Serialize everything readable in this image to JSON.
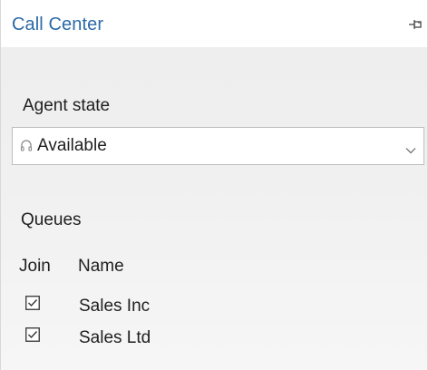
{
  "panel": {
    "title": "Call Center",
    "pin_icon": "pin-icon"
  },
  "agent_state": {
    "label": "Agent state",
    "selected_value": "Available",
    "status_icon": "headset-icon",
    "chevron_icon": "chevron-down-icon"
  },
  "queues": {
    "label": "Queues",
    "columns": {
      "join": "Join",
      "name": "Name"
    },
    "rows": [
      {
        "joined": true,
        "name": "Sales Inc"
      },
      {
        "joined": true,
        "name": "Sales Ltd"
      }
    ]
  },
  "colors": {
    "title": "#2b6aa8",
    "panel_background": "#f0f0f0",
    "border": "#bdbdbd"
  }
}
